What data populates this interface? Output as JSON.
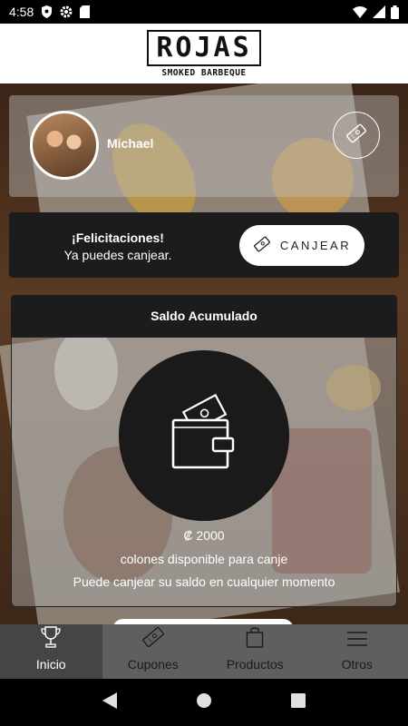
{
  "status_bar": {
    "time": "4:58"
  },
  "brand": {
    "name": "ROJAS",
    "tagline": "SMOKED BARBEQUE"
  },
  "profile": {
    "user_name": "Michael"
  },
  "redeem": {
    "title": "¡Felicitaciones!",
    "subtitle": "Ya puedes canjear.",
    "button_label": "CANJEAR"
  },
  "balance": {
    "header": "Saldo Acumulado",
    "amount": "₡ 2000",
    "note": "colones disponible para canje",
    "hint": "Puede canjear su saldo en cualquier momento"
  },
  "bottom_nav": {
    "items": [
      {
        "label": "Inicio",
        "icon": "trophy-icon",
        "active": true
      },
      {
        "label": "Cupones",
        "icon": "ticket-icon",
        "active": false
      },
      {
        "label": "Productos",
        "icon": "shopping-bag-icon",
        "active": false
      },
      {
        "label": "Otros",
        "icon": "menu-icon",
        "active": false
      }
    ]
  },
  "colors": {
    "accent_dark": "#1c1c1c",
    "nav_bg": "#5f5f5f",
    "nav_active": "#454545"
  }
}
